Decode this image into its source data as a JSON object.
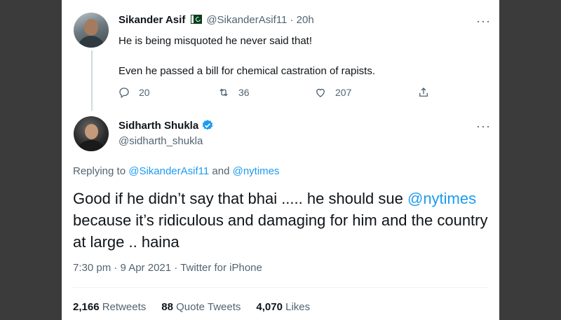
{
  "reply_tweet": {
    "author_name": "Sikander Asif",
    "handle": "@SikanderAsif11",
    "time": "20h",
    "line1": "He is being misquoted he never said that!",
    "line2": "Even he passed a bill for chemical castration of rapists.",
    "replies": "20",
    "retweets": "36",
    "likes": "207",
    "icons": {
      "flag": "pakistan-flag-icon",
      "more": "more-icon",
      "reply": "reply-icon",
      "retweet": "retweet-icon",
      "like": "like-icon",
      "share": "share-icon"
    }
  },
  "main_tweet": {
    "author_name": "Sidharth Shukla",
    "handle": "@sidharth_shukla",
    "replying_prefix": "Replying to ",
    "replying_user1": "@SikanderAsif11",
    "replying_and": " and ",
    "replying_user2": "@nytimes",
    "body_part1": "Good if he didn’t say that bhai ..... he should sue ",
    "body_mention": "@nytimes",
    "body_part2": " because it’s ridiculous and damaging for him and the country at large .. haina",
    "timestamp": "7:30 pm · 9 Apr 2021 · Twitter for iPhone",
    "stats": {
      "retweets_count": "2,166",
      "retweets_label": "Retweets",
      "quotes_count": "88",
      "quotes_label": "Quote Tweets",
      "likes_count": "4,070",
      "likes_label": "Likes"
    },
    "icons": {
      "verified": "verified-badge-icon",
      "more": "more-icon"
    }
  },
  "colors": {
    "link": "#1d9bf0",
    "muted": "#536471",
    "text": "#0f1419",
    "frame": "#3b3b3b"
  }
}
